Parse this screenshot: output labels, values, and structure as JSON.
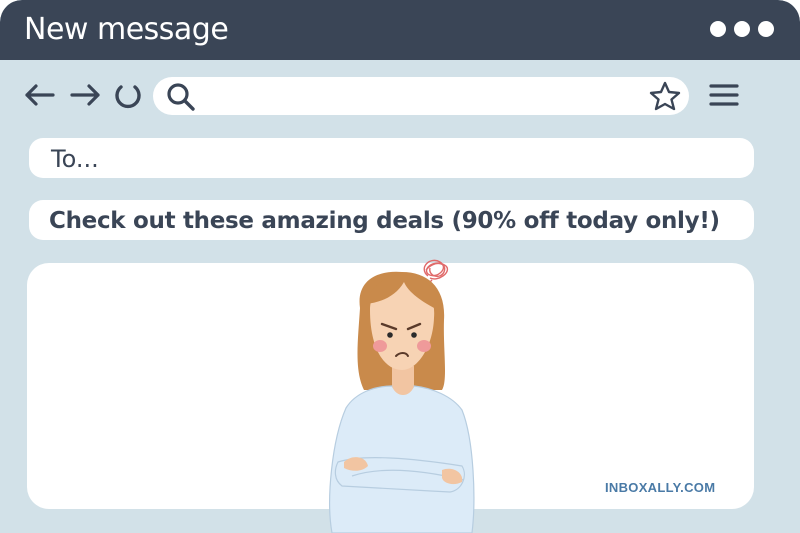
{
  "window": {
    "title": "New message",
    "menu_dots_icon": "more-dots-icon"
  },
  "toolbar": {
    "back_icon": "arrow-left-icon",
    "forward_icon": "arrow-right-icon",
    "reload_icon": "reload-icon",
    "search_icon": "search-icon",
    "bookmark_icon": "star-icon",
    "menu_icon": "hamburger-menu-icon",
    "search_value": ""
  },
  "compose": {
    "to_placeholder": "To...",
    "subject": "Check out these amazing deals (90% off today only!)",
    "body_text": ""
  },
  "illustration": {
    "subject": "frustrated woman with crossed arms",
    "scribble_icon": "frustration-scribble-icon"
  },
  "brand": "INBOXALLY.COM",
  "colors": {
    "titlebar": "#3a4556",
    "window_bg": "#d2e1e8",
    "text_dark": "#3a4556",
    "brand_blue": "#4a7aa6"
  }
}
